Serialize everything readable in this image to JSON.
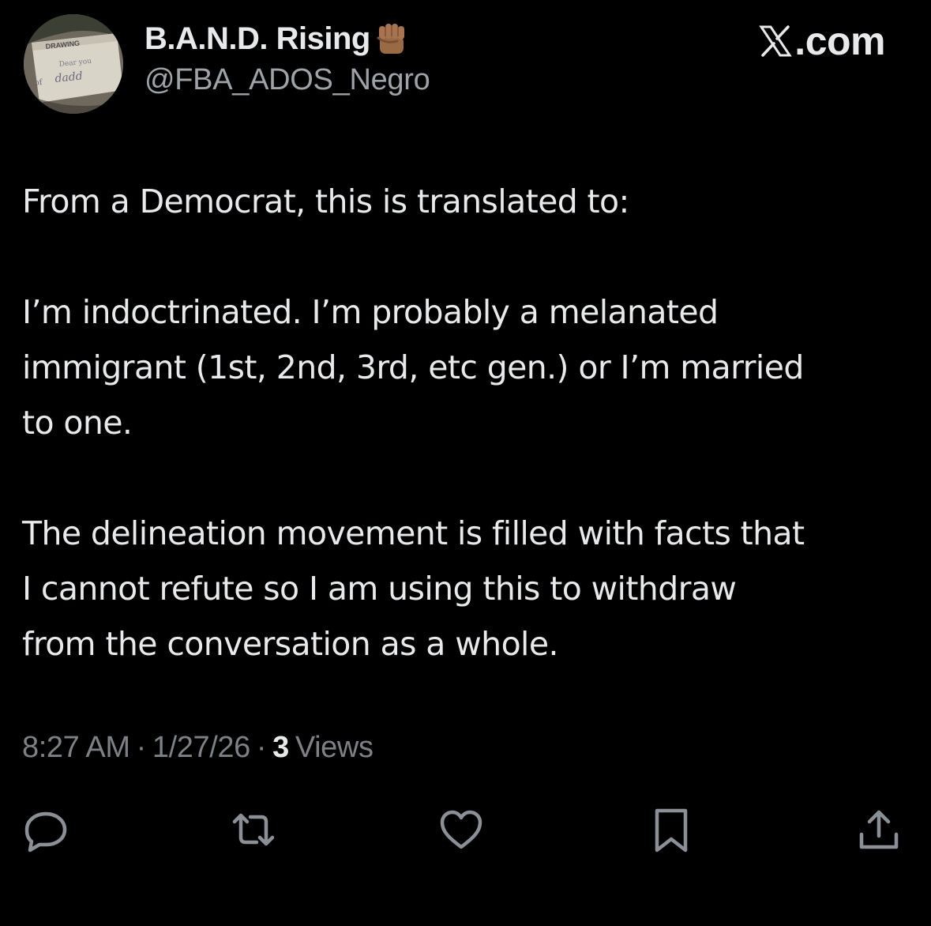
{
  "author": {
    "display_name": "B.A.N.D. Rising",
    "handle": "@FBA_ADOS_Negro",
    "name_emoji": "raised-fist-emoji",
    "avatar_texts": [
      "DRAWING",
      "dadd"
    ]
  },
  "brand": {
    "label": ".com",
    "logo": "x-logo-icon"
  },
  "tweet": {
    "paragraphs": [
      "From a Democrat, this is translated to:",
      "I’m indoctrinated. I’m probably a melanated\nimmigrant (1st, 2nd, 3rd, etc gen.) or I’m married\nto one.",
      "The delineation movement is filled with facts that\nI cannot refute so I am using this to withdraw\nfrom the conversation as a whole."
    ]
  },
  "meta": {
    "time": "8:27 AM",
    "separator": "·",
    "date": "1/27/26",
    "views_count": "3",
    "views_label": "Views"
  },
  "actions": {
    "reply": "reply-icon",
    "repost": "repost-icon",
    "like": "heart-icon",
    "bookmark": "bookmark-icon",
    "share": "share-icon"
  },
  "colors": {
    "background": "#000000",
    "primary_text": "#e7e9ea",
    "secondary_text": "#7d8185",
    "handle_text": "#9ea3a8"
  }
}
